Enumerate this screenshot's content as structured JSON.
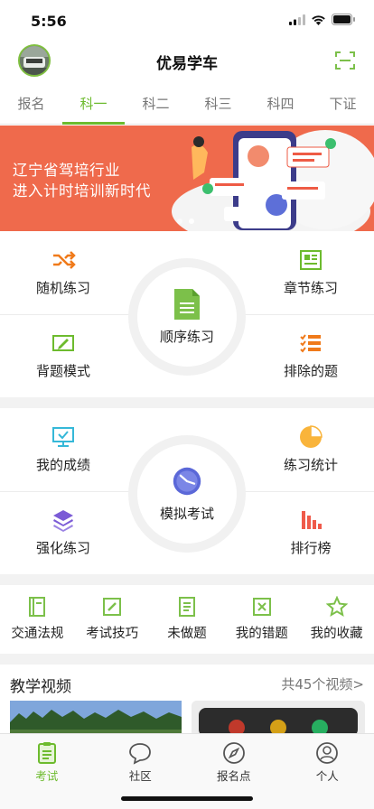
{
  "status": {
    "time": "5:56"
  },
  "header": {
    "title": "优易学车"
  },
  "tabs": [
    {
      "label": "报名"
    },
    {
      "label": "科一",
      "active": true
    },
    {
      "label": "科二"
    },
    {
      "label": "科三"
    },
    {
      "label": "科四"
    },
    {
      "label": "下证"
    }
  ],
  "banner": {
    "line1": "辽宁省驾培行业",
    "line2": "进入计时培训新时代",
    "page_count": 2,
    "current_page": 2
  },
  "practice": {
    "random": "随机练习",
    "chapter": "章节练习",
    "sequential": "顺序练习",
    "memorize": "背题模式",
    "exclude": "排除的题"
  },
  "exam": {
    "scores": "我的成绩",
    "stats": "练习统计",
    "mock": "模拟考试",
    "intensive": "强化练习",
    "ranking": "排行榜"
  },
  "quick_links": [
    {
      "label": "交通法规",
      "icon": "law-book-icon"
    },
    {
      "label": "考试技巧",
      "icon": "edit-icon"
    },
    {
      "label": "未做题",
      "icon": "document-icon"
    },
    {
      "label": "我的错题",
      "icon": "wrong-box-icon"
    },
    {
      "label": "我的收藏",
      "icon": "star-icon"
    }
  ],
  "videos": {
    "title": "教学视频",
    "more": "共45个视频>"
  },
  "bottom_nav": [
    {
      "label": "考试",
      "icon": "exam-clipboard-icon",
      "active": true
    },
    {
      "label": "社区",
      "icon": "chat-bubble-icon"
    },
    {
      "label": "报名点",
      "icon": "compass-icon"
    },
    {
      "label": "个人",
      "icon": "person-icon"
    }
  ],
  "colors": {
    "accent": "#6dbb2e",
    "banner": "#ef6a4c",
    "divider": "#f2f2f2"
  }
}
